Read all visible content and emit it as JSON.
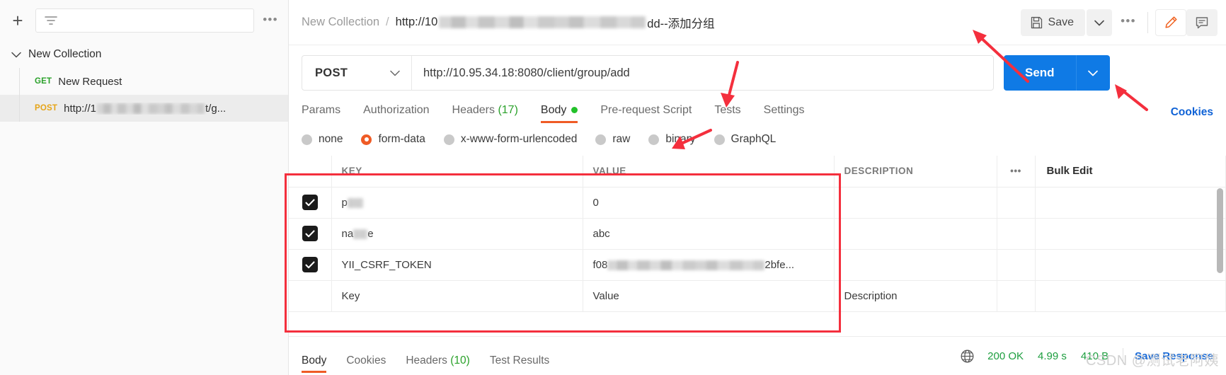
{
  "sidebar": {
    "add_button": "+",
    "filter_icon": "filter-icon",
    "more_dots": "•••",
    "collection": {
      "name": "New Collection",
      "expanded_icon": "chevron-down-icon"
    },
    "requests": [
      {
        "method": "GET",
        "label": "New Request",
        "selected": false,
        "redacted": false
      },
      {
        "method": "POST",
        "label": "http://1",
        "label_suffix": "t/g...",
        "selected": true,
        "redacted": true
      }
    ]
  },
  "header": {
    "breadcrumb_collection": "New Collection",
    "breadcrumb_separator": "/",
    "breadcrumb_current_prefix": "http://10",
    "breadcrumb_current_suffix": "dd--添加分组",
    "save_label": "Save",
    "save_icon": "floppy-disk-icon",
    "save_caret_icon": "chevron-down-icon",
    "more_dots": "•••",
    "edit_icon": "pencil-icon",
    "comment_icon": "comment-icon"
  },
  "url_bar": {
    "method": "POST",
    "method_caret_icon": "chevron-down-icon",
    "url": "http://10.95.34.18:8080/client/group/add",
    "send_label": "Send",
    "send_caret_icon": "chevron-down-icon",
    "cookies_label": "Cookies"
  },
  "request_tabs": [
    {
      "label": "Params",
      "active": false
    },
    {
      "label": "Authorization",
      "active": false
    },
    {
      "label": "Headers",
      "count": "(17)",
      "active": false
    },
    {
      "label": "Body",
      "active": true,
      "dot": true
    },
    {
      "label": "Pre-request Script",
      "active": false
    },
    {
      "label": "Tests",
      "active": false
    },
    {
      "label": "Settings",
      "active": false
    }
  ],
  "body_types": [
    {
      "label": "none",
      "selected": false
    },
    {
      "label": "form-data",
      "selected": true
    },
    {
      "label": "x-www-form-urlencoded",
      "selected": false
    },
    {
      "label": "raw",
      "selected": false
    },
    {
      "label": "binary",
      "selected": false
    },
    {
      "label": "GraphQL",
      "selected": false
    }
  ],
  "kv_table": {
    "headers": {
      "key": "KEY",
      "value": "VALUE",
      "description": "DESCRIPTION",
      "dots": "•••",
      "bulk_edit": "Bulk Edit"
    },
    "rows": [
      {
        "checked": true,
        "key": "p",
        "key_redacted": true,
        "value": "0",
        "value_redacted": false,
        "description": ""
      },
      {
        "checked": true,
        "key": "na",
        "key_redacted": true,
        "key_suffix": "e",
        "value": "abc",
        "value_redacted": false,
        "description": ""
      },
      {
        "checked": true,
        "key": "YII_CSRF_TOKEN",
        "key_redacted": false,
        "value": "f08",
        "value_redacted": true,
        "value_suffix": "2bfe...",
        "description": ""
      }
    ],
    "placeholder_row": {
      "key": "Key",
      "value": "Value",
      "description": "Description"
    }
  },
  "response_bar": {
    "tabs": [
      {
        "label": "Body",
        "active": true
      },
      {
        "label": "Cookies",
        "active": false
      },
      {
        "label": "Headers",
        "count": "(10)",
        "active": false
      },
      {
        "label": "Test Results",
        "active": false
      }
    ],
    "globe_icon": "globe-icon",
    "status": "200 OK",
    "time": "4.99 s",
    "size": "410 B",
    "save_response": "Save Response"
  },
  "watermark": "CSDN @测试老阿姨",
  "colors": {
    "accent_orange": "#ef5b25",
    "send_blue": "#0f7ae5",
    "link_blue": "#1668d6",
    "success_green": "#1d9e3f",
    "annotation_red": "#f42f3d",
    "post_orange": "#e6a417",
    "get_green": "#2aa12a"
  }
}
